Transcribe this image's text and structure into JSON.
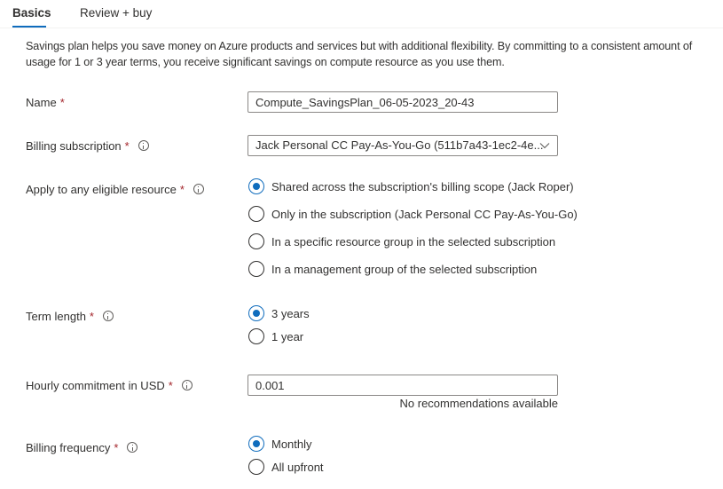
{
  "tabs": [
    {
      "label": "Basics",
      "active": true
    },
    {
      "label": "Review + buy",
      "active": false
    }
  ],
  "description": "Savings plan helps you save money on Azure products and services but with additional flexibility. By committing to a consistent amount of usage for 1 or 3 year terms, you receive significant savings on compute resource as you use them.",
  "required_marker": "*",
  "accent_color": "#0f6cbd",
  "required_color": "#a4262c",
  "fields": {
    "name": {
      "label": "Name",
      "value": "Compute_SavingsPlan_06-05-2023_20-43"
    },
    "billing_subscription": {
      "label": "Billing subscription",
      "info_icon": "info-icon",
      "selected": "Jack Personal CC Pay-As-You-Go (511b7a43-1ec2-4e...",
      "dropdown_icon": "chevron-down-icon"
    },
    "apply_scope": {
      "label": "Apply to any eligible resource",
      "info_icon": "info-icon",
      "options": [
        {
          "label": "Shared across the subscription's billing scope (Jack Roper)",
          "checked": true
        },
        {
          "label": "Only in the subscription (Jack Personal CC Pay-As-You-Go)",
          "checked": false
        },
        {
          "label": "In a specific resource group in the selected subscription",
          "checked": false
        },
        {
          "label": "In a management group of the selected subscription",
          "checked": false
        }
      ]
    },
    "term_length": {
      "label": "Term length",
      "info_icon": "info-icon",
      "options": [
        {
          "label": "3 years",
          "checked": true
        },
        {
          "label": "1 year",
          "checked": false
        }
      ]
    },
    "hourly_commitment": {
      "label": "Hourly commitment in USD",
      "info_icon": "info-icon",
      "value": "0.001",
      "hint": "No recommendations available"
    },
    "billing_frequency": {
      "label": "Billing frequency",
      "info_icon": "info-icon",
      "options": [
        {
          "label": "Monthly",
          "checked": true
        },
        {
          "label": "All upfront",
          "checked": false
        }
      ]
    }
  }
}
